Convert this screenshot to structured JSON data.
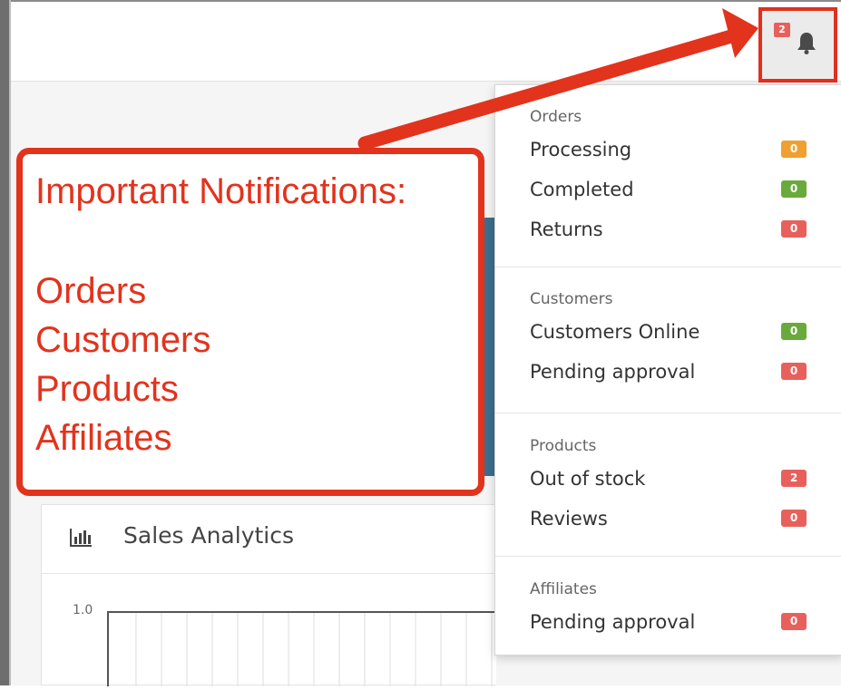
{
  "colors": {
    "accent_red": "#e2331d",
    "badge_orange": "#f0a030",
    "badge_green": "#6aaa3c",
    "badge_red": "#e8605c"
  },
  "notifications": {
    "bell_icon": "bell-icon",
    "badge_count": "2"
  },
  "annotation": {
    "heading": "Important Notifications:",
    "items": [
      "Orders",
      "Customers",
      "Products",
      "Affiliates"
    ]
  },
  "background": {
    "sales_panel_title": "Sales Analytics",
    "sales_panel_icon": "bar-chart-icon",
    "chart_y_tick": "1.0"
  },
  "dropdown": {
    "sections": [
      {
        "title": "Orders",
        "items": [
          {
            "label": "Processing",
            "count": "0",
            "status": "orange"
          },
          {
            "label": "Completed",
            "count": "0",
            "status": "green"
          },
          {
            "label": "Returns",
            "count": "0",
            "status": "red"
          }
        ]
      },
      {
        "title": "Customers",
        "items": [
          {
            "label": "Customers Online",
            "count": "0",
            "status": "green"
          },
          {
            "label": "Pending approval",
            "count": "0",
            "status": "red"
          }
        ]
      },
      {
        "title": "Products",
        "items": [
          {
            "label": "Out of stock",
            "count": "2",
            "status": "red"
          },
          {
            "label": "Reviews",
            "count": "0",
            "status": "red"
          }
        ]
      },
      {
        "title": "Affiliates",
        "items": [
          {
            "label": "Pending approval",
            "count": "0",
            "status": "red"
          }
        ]
      }
    ]
  }
}
